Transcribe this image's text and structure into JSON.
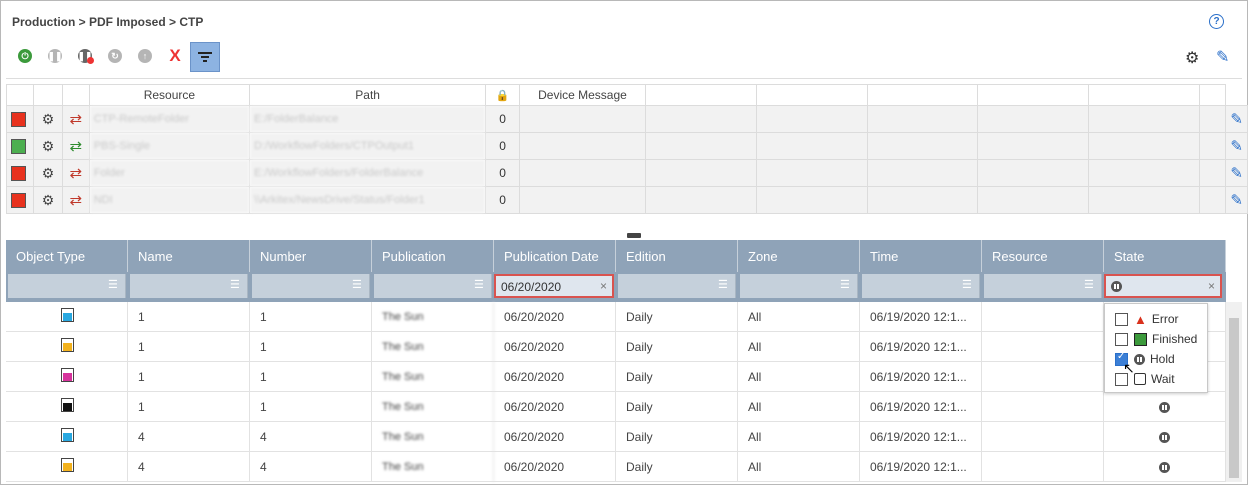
{
  "breadcrumb": "Production > PDF Imposed > CTP",
  "toolbar": {
    "items": [
      "power-icon",
      "pause-icon",
      "pause-error-icon",
      "refresh-icon",
      "upload-icon",
      "delete-icon",
      "filter-icon"
    ],
    "delete_glyph": "X"
  },
  "resource_table": {
    "headers": [
      "Resource",
      "Path",
      "",
      "Device Message"
    ],
    "rows": [
      {
        "status_color": "#e8321e",
        "swap_color": "#c0392b",
        "resource": "CTP-RemoteFolder",
        "path": "E:/FolderBalance",
        "count": "0"
      },
      {
        "status_color": "#4caf50",
        "swap_color": "#2e8b2e",
        "resource": "PBS-Single",
        "path": "D:/WorkflowFolders/CTPOutput1",
        "count": "0"
      },
      {
        "status_color": "#e8321e",
        "swap_color": "#c0392b",
        "resource": "Folder",
        "path": "E:/WorkflowFolders/FolderBalance",
        "count": "0"
      },
      {
        "status_color": "#e8321e",
        "swap_color": "#c0392b",
        "resource": "NDI",
        "path": "\\\\Arkitex/NewsDrive/Status/Folder1",
        "count": "0"
      }
    ]
  },
  "grid": {
    "headers": [
      "Object Type",
      "Name",
      "Number",
      "Publication",
      "Publication Date",
      "Edition",
      "Zone",
      "Time",
      "Resource",
      "State"
    ],
    "filter_date": "06/20/2020",
    "clear_glyph": "×",
    "rows": [
      {
        "color": "#29a8e0",
        "name": "1",
        "number": "1",
        "publication": "The Sun",
        "date": "06/20/2020",
        "edition": "Daily",
        "zone": "All",
        "time": "06/19/2020 12:1..."
      },
      {
        "color": "#f3b21d",
        "name": "1",
        "number": "1",
        "publication": "The Sun",
        "date": "06/20/2020",
        "edition": "Daily",
        "zone": "All",
        "time": "06/19/2020 12:1..."
      },
      {
        "color": "#d6339c",
        "name": "1",
        "number": "1",
        "publication": "The Sun",
        "date": "06/20/2020",
        "edition": "Daily",
        "zone": "All",
        "time": "06/19/2020 12:1..."
      },
      {
        "color": "#111111",
        "name": "1",
        "number": "1",
        "publication": "The Sun",
        "date": "06/20/2020",
        "edition": "Daily",
        "zone": "All",
        "time": "06/19/2020 12:1..."
      },
      {
        "color": "#29a8e0",
        "name": "4",
        "number": "4",
        "publication": "The Sun",
        "date": "06/20/2020",
        "edition": "Daily",
        "zone": "All",
        "time": "06/19/2020 12:1..."
      },
      {
        "color": "#f3b21d",
        "name": "4",
        "number": "4",
        "publication": "The Sun",
        "date": "06/20/2020",
        "edition": "Daily",
        "zone": "All",
        "time": "06/19/2020 12:1..."
      }
    ]
  },
  "state_dropdown": {
    "options": [
      {
        "label": "Error",
        "checked": false
      },
      {
        "label": "Finished",
        "checked": false
      },
      {
        "label": "Hold",
        "checked": true
      },
      {
        "label": "Wait",
        "checked": false
      }
    ]
  }
}
